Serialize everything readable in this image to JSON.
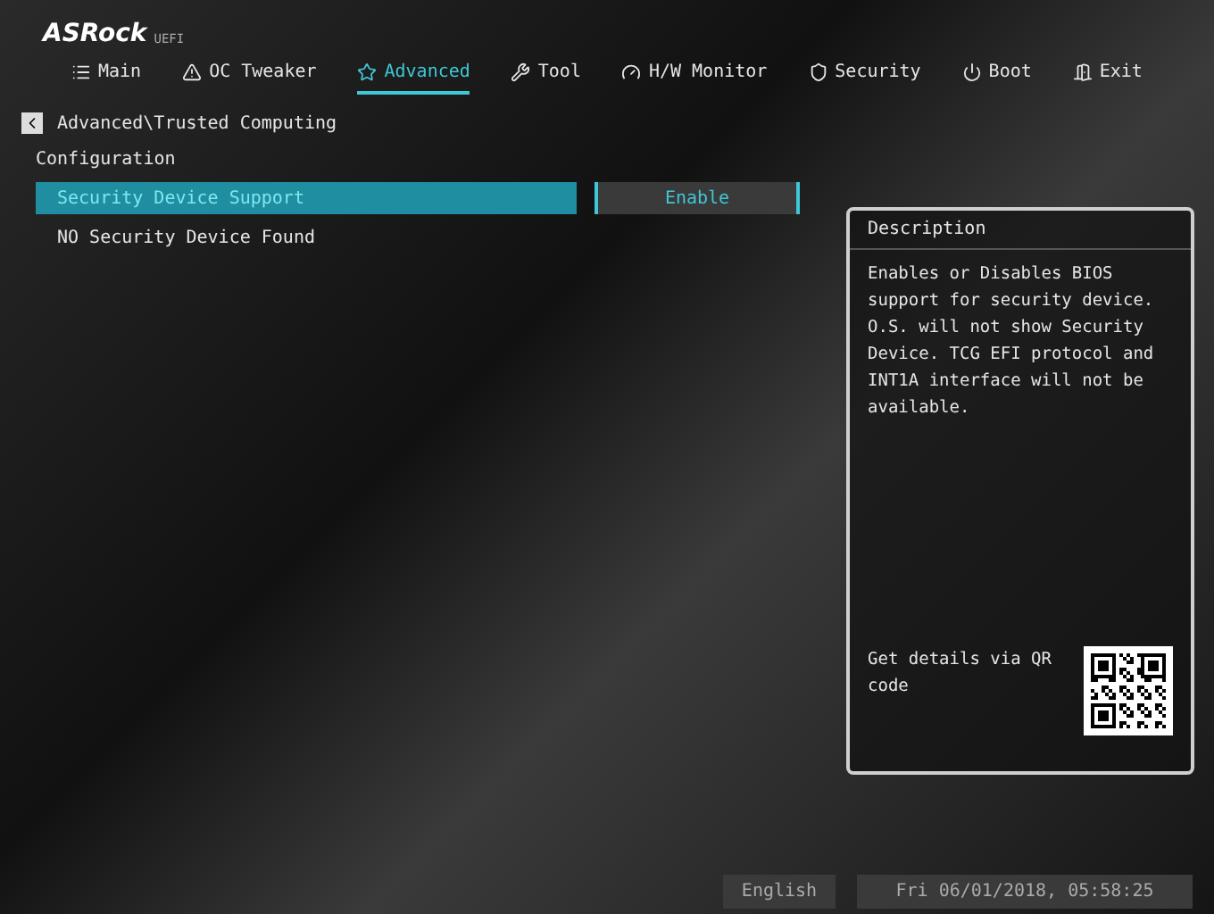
{
  "logo": {
    "brand": "ASRock",
    "suffix": "UEFI"
  },
  "tabs": [
    {
      "label": "Main",
      "kind": "list",
      "selected": false
    },
    {
      "label": "OC Tweaker",
      "kind": "triangle",
      "selected": false
    },
    {
      "label": "Advanced",
      "kind": "star",
      "selected": true
    },
    {
      "label": "Tool",
      "kind": "tools",
      "selected": false
    },
    {
      "label": "H/W Monitor",
      "kind": "gauge",
      "selected": false
    },
    {
      "label": "Security",
      "kind": "shield",
      "selected": false
    },
    {
      "label": "Boot",
      "kind": "power",
      "selected": false
    },
    {
      "label": "Exit",
      "kind": "door",
      "selected": false
    }
  ],
  "breadcrumb": "Advanced\\Trusted Computing",
  "section": "Configuration",
  "items": [
    {
      "kind": "setting",
      "label": "Security Device Support",
      "value": "Enable",
      "selected": true
    },
    {
      "kind": "info",
      "label": "NO Security Device Found"
    }
  ],
  "description": {
    "title": "Description",
    "text": "Enables or Disables BIOS support for security device. O.S. will not show Security Device. TCG EFI protocol and INT1A interface will not be available.",
    "qr_text": "Get details via QR code"
  },
  "footer": {
    "language": "English",
    "datetime": "Fri 06/01/2018, 05:58:25"
  }
}
